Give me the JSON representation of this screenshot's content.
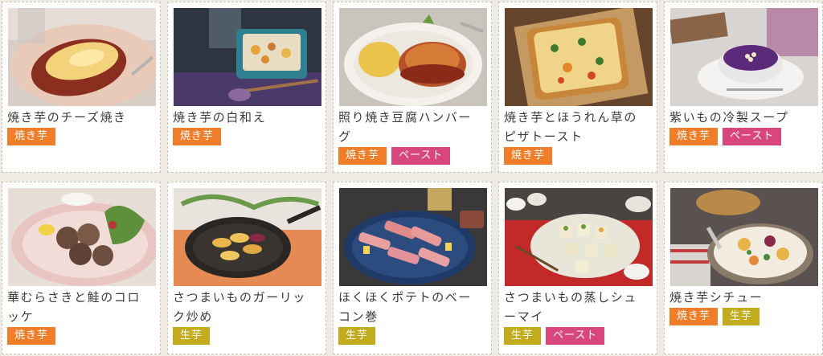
{
  "recipes": [
    {
      "title": "焼き芋のチーズ焼き",
      "tags": [
        "焼き芋"
      ]
    },
    {
      "title": "焼き芋の白和え",
      "tags": [
        "焼き芋"
      ]
    },
    {
      "title": "照り焼き豆腐ハンバー\nグ",
      "tags": [
        "焼き芋",
        "ペースト"
      ]
    },
    {
      "title": "焼き芋とほうれん草の\nピザトースト",
      "tags": [
        "焼き芋"
      ]
    },
    {
      "title": "紫いもの冷製スープ",
      "tags": [
        "焼き芋",
        "ペースト"
      ]
    },
    {
      "title": "華むらさきと鮭のコロ\nッケ",
      "tags": [
        "焼き芋"
      ]
    },
    {
      "title": "さつまいものガーリッ\nク炒め",
      "tags": [
        "生芋"
      ]
    },
    {
      "title": "ほくほくポテトのベー\nコン巻",
      "tags": [
        "生芋"
      ]
    },
    {
      "title": "さつまいもの蒸しシュ\nーマイ",
      "tags": [
        "生芋",
        "ペースト"
      ]
    },
    {
      "title": "焼き芋シチュー",
      "tags": [
        "焼き芋",
        "生芋"
      ]
    }
  ],
  "tag_colors": {
    "焼き芋": "#f07d2a",
    "ペースト": "#d9457d",
    "生芋": "#c4ab1d"
  }
}
